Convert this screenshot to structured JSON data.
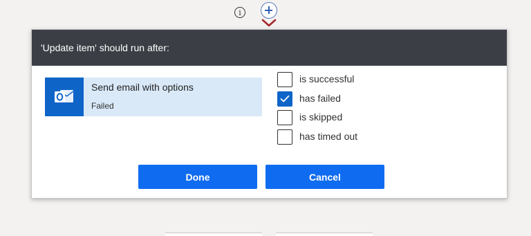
{
  "canvas": {
    "info_glyph": "i",
    "info_icon": "info-icon",
    "add_icon": "plus-circle-icon",
    "connector_icon": "chevron-down-icon"
  },
  "dialog": {
    "title": "'Update item' should run after:",
    "action": {
      "name": "Send email with options",
      "status": "Failed",
      "icon": "outlook-icon",
      "accent_color": "#0f64c8"
    },
    "conditions": [
      {
        "label": "is successful",
        "checked": false
      },
      {
        "label": "has failed",
        "checked": true
      },
      {
        "label": "is skipped",
        "checked": false
      },
      {
        "label": "has timed out",
        "checked": false
      }
    ],
    "buttons": {
      "done": "Done",
      "cancel": "Cancel"
    }
  },
  "colors": {
    "header_bg": "#3b3f45",
    "button_bg": "#0f6cf0",
    "card_bg": "#d9e9f8"
  }
}
